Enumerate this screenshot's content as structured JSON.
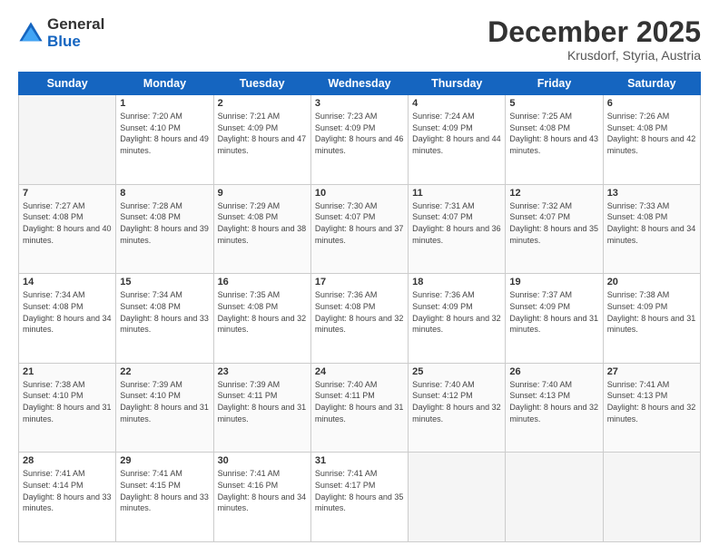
{
  "logo": {
    "general": "General",
    "blue": "Blue"
  },
  "header": {
    "month": "December 2025",
    "location": "Krusdorf, Styria, Austria"
  },
  "weekdays": [
    "Sunday",
    "Monday",
    "Tuesday",
    "Wednesday",
    "Thursday",
    "Friday",
    "Saturday"
  ],
  "weeks": [
    [
      {
        "day": "",
        "empty": true
      },
      {
        "day": "1",
        "sunrise": "7:20 AM",
        "sunset": "4:10 PM",
        "daylight": "8 hours and 49 minutes."
      },
      {
        "day": "2",
        "sunrise": "7:21 AM",
        "sunset": "4:09 PM",
        "daylight": "8 hours and 47 minutes."
      },
      {
        "day": "3",
        "sunrise": "7:23 AM",
        "sunset": "4:09 PM",
        "daylight": "8 hours and 46 minutes."
      },
      {
        "day": "4",
        "sunrise": "7:24 AM",
        "sunset": "4:09 PM",
        "daylight": "8 hours and 44 minutes."
      },
      {
        "day": "5",
        "sunrise": "7:25 AM",
        "sunset": "4:08 PM",
        "daylight": "8 hours and 43 minutes."
      },
      {
        "day": "6",
        "sunrise": "7:26 AM",
        "sunset": "4:08 PM",
        "daylight": "8 hours and 42 minutes."
      }
    ],
    [
      {
        "day": "7",
        "sunrise": "7:27 AM",
        "sunset": "4:08 PM",
        "daylight": "8 hours and 40 minutes."
      },
      {
        "day": "8",
        "sunrise": "7:28 AM",
        "sunset": "4:08 PM",
        "daylight": "8 hours and 39 minutes."
      },
      {
        "day": "9",
        "sunrise": "7:29 AM",
        "sunset": "4:08 PM",
        "daylight": "8 hours and 38 minutes."
      },
      {
        "day": "10",
        "sunrise": "7:30 AM",
        "sunset": "4:07 PM",
        "daylight": "8 hours and 37 minutes."
      },
      {
        "day": "11",
        "sunrise": "7:31 AM",
        "sunset": "4:07 PM",
        "daylight": "8 hours and 36 minutes."
      },
      {
        "day": "12",
        "sunrise": "7:32 AM",
        "sunset": "4:07 PM",
        "daylight": "8 hours and 35 minutes."
      },
      {
        "day": "13",
        "sunrise": "7:33 AM",
        "sunset": "4:08 PM",
        "daylight": "8 hours and 34 minutes."
      }
    ],
    [
      {
        "day": "14",
        "sunrise": "7:34 AM",
        "sunset": "4:08 PM",
        "daylight": "8 hours and 34 minutes."
      },
      {
        "day": "15",
        "sunrise": "7:34 AM",
        "sunset": "4:08 PM",
        "daylight": "8 hours and 33 minutes."
      },
      {
        "day": "16",
        "sunrise": "7:35 AM",
        "sunset": "4:08 PM",
        "daylight": "8 hours and 32 minutes."
      },
      {
        "day": "17",
        "sunrise": "7:36 AM",
        "sunset": "4:08 PM",
        "daylight": "8 hours and 32 minutes."
      },
      {
        "day": "18",
        "sunrise": "7:36 AM",
        "sunset": "4:09 PM",
        "daylight": "8 hours and 32 minutes."
      },
      {
        "day": "19",
        "sunrise": "7:37 AM",
        "sunset": "4:09 PM",
        "daylight": "8 hours and 31 minutes."
      },
      {
        "day": "20",
        "sunrise": "7:38 AM",
        "sunset": "4:09 PM",
        "daylight": "8 hours and 31 minutes."
      }
    ],
    [
      {
        "day": "21",
        "sunrise": "7:38 AM",
        "sunset": "4:10 PM",
        "daylight": "8 hours and 31 minutes."
      },
      {
        "day": "22",
        "sunrise": "7:39 AM",
        "sunset": "4:10 PM",
        "daylight": "8 hours and 31 minutes."
      },
      {
        "day": "23",
        "sunrise": "7:39 AM",
        "sunset": "4:11 PM",
        "daylight": "8 hours and 31 minutes."
      },
      {
        "day": "24",
        "sunrise": "7:40 AM",
        "sunset": "4:11 PM",
        "daylight": "8 hours and 31 minutes."
      },
      {
        "day": "25",
        "sunrise": "7:40 AM",
        "sunset": "4:12 PM",
        "daylight": "8 hours and 32 minutes."
      },
      {
        "day": "26",
        "sunrise": "7:40 AM",
        "sunset": "4:13 PM",
        "daylight": "8 hours and 32 minutes."
      },
      {
        "day": "27",
        "sunrise": "7:41 AM",
        "sunset": "4:13 PM",
        "daylight": "8 hours and 32 minutes."
      }
    ],
    [
      {
        "day": "28",
        "sunrise": "7:41 AM",
        "sunset": "4:14 PM",
        "daylight": "8 hours and 33 minutes."
      },
      {
        "day": "29",
        "sunrise": "7:41 AM",
        "sunset": "4:15 PM",
        "daylight": "8 hours and 33 minutes."
      },
      {
        "day": "30",
        "sunrise": "7:41 AM",
        "sunset": "4:16 PM",
        "daylight": "8 hours and 34 minutes."
      },
      {
        "day": "31",
        "sunrise": "7:41 AM",
        "sunset": "4:17 PM",
        "daylight": "8 hours and 35 minutes."
      },
      {
        "day": "",
        "empty": true
      },
      {
        "day": "",
        "empty": true
      },
      {
        "day": "",
        "empty": true
      }
    ]
  ]
}
